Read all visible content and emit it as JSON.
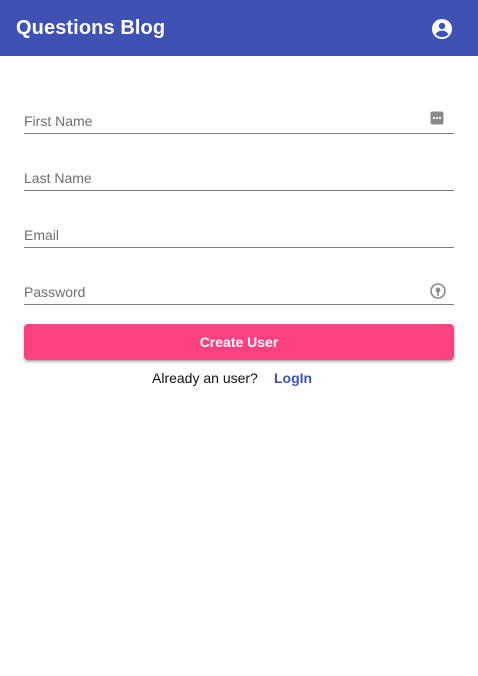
{
  "header": {
    "title": "Questions Blog",
    "account_icon": "account-circle-icon",
    "background_color": "#3f51b5"
  },
  "form": {
    "first_name": {
      "placeholder": "First Name",
      "value": "",
      "icon": "password-manager-icon"
    },
    "last_name": {
      "placeholder": "Last Name",
      "value": ""
    },
    "email": {
      "placeholder": "Email",
      "value": ""
    },
    "password": {
      "placeholder": "Password",
      "value": "",
      "icon": "key-autofill-icon"
    },
    "submit_label": "Create User",
    "submit_color": "#ff4081"
  },
  "footer": {
    "prompt": "Already an user?",
    "login_label": "LogIn",
    "link_color": "#3f51b5"
  }
}
